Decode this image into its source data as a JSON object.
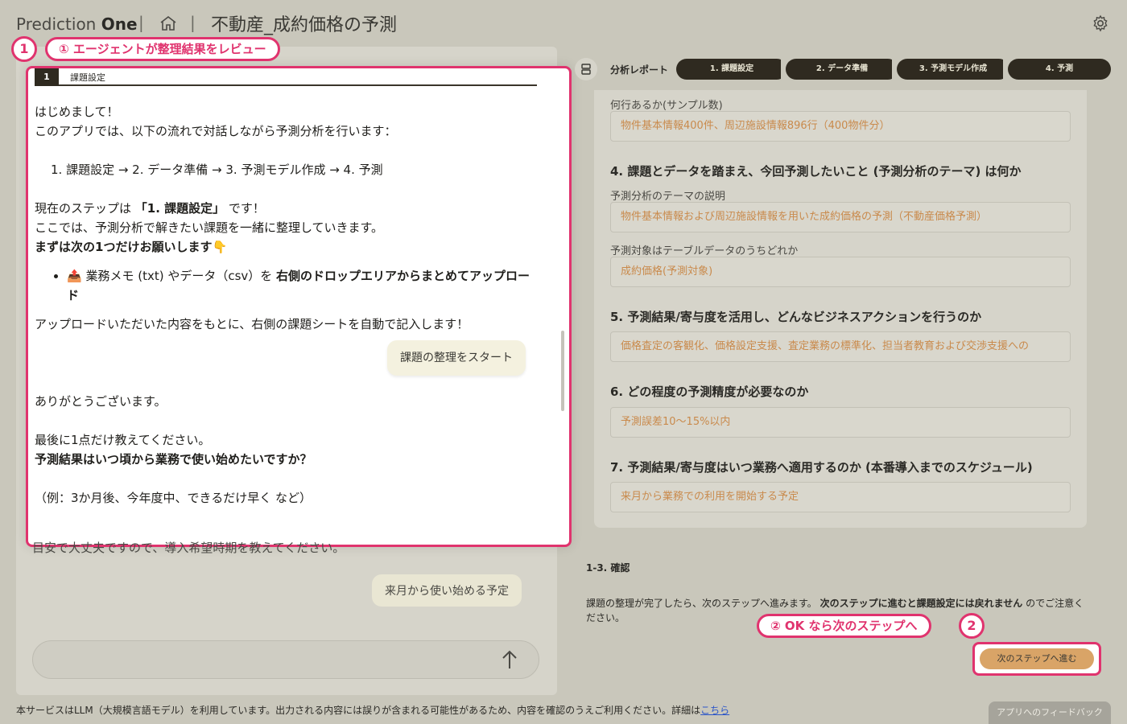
{
  "header": {
    "logo_prefix": "Prediction ",
    "logo_bold": "One",
    "separator": "|",
    "page_title": "不動産_成約価格の予測"
  },
  "annotations": {
    "badge1": "1",
    "pill1": "① エージェントが整理結果をレビュー",
    "badge2": "2",
    "pill2": "② OK なら次のステップへ"
  },
  "chat": {
    "tab_number": "1",
    "tab_label": "課題設定",
    "line1": "はじめまして！",
    "line2": "このアプリでは、以下の流れで対話しながら予測分析を行います：",
    "flow": "1. 課題設定 → 2. データ準備 → 3. 予測モデル作成 → 4. 予測",
    "step_prefix": "現在のステップは ",
    "step_bold": "「1. 課題設定」",
    "step_suffix": " です！",
    "line_here": "ここでは、予測分析で解きたい課題を一緒に整理していきます。",
    "line_first": "まずは次の1つだけお願いします👇",
    "bullet_prefix": "📤 業務メモ (txt) やデータ（csv）を ",
    "bullet_bold": "右側のドロップエリアからまとめてアップロード",
    "line_upload": "アップロードいただいた内容をもとに、右側の課題シートを自動で記入します！",
    "user_bubble1": "課題の整理をスタート",
    "line_thanks": "ありがとうございます。",
    "line_last": "最後に1点だけ教えてください。",
    "line_question": "予測結果はいつ頃から業務で使い始めたいですか？",
    "line_example": "（例：3か月後、今年度中、できるだけ早く など）",
    "line_overflow": "目安で大丈夫ですので、導入希望時期を教えてください。",
    "user_bubble2": "来月から使い始める予定"
  },
  "report": {
    "label": "分析レポート",
    "steps": [
      "1. 課題設定",
      "2. データ準備",
      "3. 予測モデル作成",
      "4. 予測"
    ]
  },
  "sheet": {
    "rows_label": "何行あるか(サンプル数)",
    "rows_value": "物件基本情報400件、周辺施設情報896行（400物件分）",
    "q4": "4. 課題とデータを踏まえ、今回予測したいこと (予測分析のテーマ) は何か",
    "theme_label": "予測分析のテーマの説明",
    "theme_value": "物件基本情報および周辺施設情報を用いた成約価格の予測（不動産価格予測）",
    "target_label": "予測対象はテーブルデータのうちどれか",
    "target_value": "成約価格(予測対象)",
    "q5": "5. 予測結果/寄与度を活用し、どんなビジネスアクションを行うのか",
    "action_value": "価格査定の客観化、価格設定支援、査定業務の標準化、担当者教育および交渉支援への",
    "q6": "6. どの程度の予測精度が必要なのか",
    "accuracy_value": "予測誤差10～15%以内",
    "q7": "7. 予測結果/寄与度はいつ業務へ適用するのか (本番導入までのスケジュール)",
    "schedule_value": "来月から業務での利用を開始する予定"
  },
  "confirm": {
    "title": "1-3. 確認",
    "text_prefix": "課題の整理が完了したら、次のステップへ進みます。",
    "text_bold": "次のステップに進むと課題設定には戻れません",
    "text_suffix": "のでご注意ください。",
    "next_button": "次のステップへ進む"
  },
  "footer": {
    "text": "本サービスはLLM（大規模言語モデル）を利用しています。出力される内容には誤りが含まれる可能性があるため、内容を確認のうえご利用ください。詳細は",
    "link": "こちら",
    "feedback": "アプリへのフィードバック"
  }
}
